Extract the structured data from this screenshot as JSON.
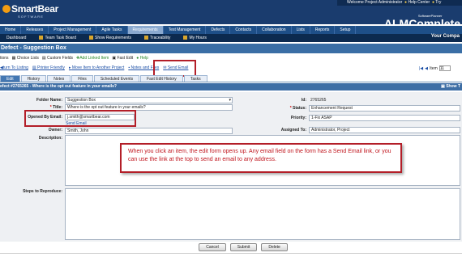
{
  "header": {
    "logo": "SmartBear",
    "logo_sub": "SOFTWARE",
    "welcome": "Welcome Project Administrator",
    "help_center": "Help Center",
    "try": "Try",
    "brand": "ALMComplete",
    "brand_sup": "SoftwarePlanner"
  },
  "main_nav": [
    "Home",
    "Releases",
    "Project Management",
    "Agile Tasks",
    "Requirements",
    "Test Management",
    "Defects",
    "Contacts",
    "Collaboration",
    "Lists",
    "Reports",
    "Setup"
  ],
  "main_nav_active": 4,
  "sub_nav": {
    "dashboard": "Dashboard",
    "team_task_board": "Team Task Board",
    "show_requirements": "Show Requirements",
    "traceability": "Traceability",
    "my_hours": "My Hours",
    "your_company": "Your Compa"
  },
  "title": "Defect - Suggestion Box",
  "toolbar1": {
    "options": "tions",
    "choice_lists": "Choice Lists",
    "custom_fields": "Custom Fields",
    "add_linked_item": "Add Linked Item",
    "fast_edit": "Fast Edit",
    "help": "Help"
  },
  "toolbar2": {
    "return": "turn To Listing",
    "printer": "Printer Friendly",
    "move_item": "Move Item to Another Project",
    "notes_files": "Notes and Files",
    "send_email": "Send Email"
  },
  "pager": {
    "item_label": "Item",
    "item_value": "11"
  },
  "form_tabs": [
    "Edit",
    "History",
    "Notes",
    "Files",
    "Scheduled Events",
    "Fast Edit History",
    "Tasks"
  ],
  "form_tabs_active": 0,
  "issue_bar": "efect #2765265 - Where is the opt out feature in your emails?",
  "issue_bar_show": "Show T",
  "form": {
    "folder_name_label": "Folder Name:",
    "folder_name": "Suggestion Box",
    "title_label": "Title:",
    "title_value": "Where is the opt out feature in your emails?",
    "opened_by_email_label": "Opened By Email:",
    "opened_by_email": "j.smith@smartbear.com",
    "send_email_link": "Send Email",
    "owner_label": "Owner:",
    "owner_value": "Smith, John",
    "description_label": "Description:",
    "steps_label": "Steps to Reproduce:",
    "id_label": "Id:",
    "id_value": "2765265",
    "status_label": "Status:",
    "status_value": "Enhancement Request",
    "priority_label": "Priority:",
    "priority_value": "1-Fix ASAP",
    "assigned_label": "Assigned To:",
    "assigned_value": "Administrator, Project"
  },
  "callout": "When you click an item, the edit form opens up. Any email field on the form has a Send Email link, or you can use the link at the top to send an email to any address.",
  "buttons": {
    "cancel": "Cancel",
    "submit": "Submit",
    "delete": "Delete"
  },
  "colors": {
    "header": "#1a3c6e",
    "nav": "#1e4f88",
    "highlight": "#b31e28"
  }
}
